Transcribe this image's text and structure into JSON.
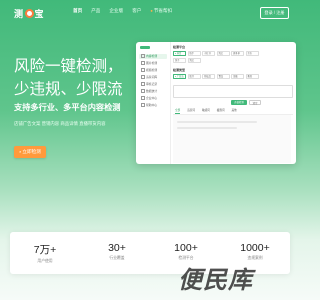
{
  "header": {
    "logo_text_left": "测",
    "logo_text_right": "宝",
    "nav": [
      {
        "label": "首页",
        "active": true
      },
      {
        "label": "产品"
      },
      {
        "label": "企业版"
      },
      {
        "label": "客户"
      },
      {
        "label": "节省帮扣",
        "hot": true
      }
    ],
    "login_label": "登录 / 注册"
  },
  "hero": {
    "title": "风险一键检测，少违规、少限流",
    "subtitle": "支持多行业、多平台内容检测",
    "tags": "店铺广告文案  营销内容  商品详情  直播带货内容",
    "cta_label": "立即检测"
  },
  "mockup": {
    "sidebar": [
      "内容检测",
      "图片检测",
      "视频检测",
      "违禁词库",
      "审核记录",
      "数据统计",
      "企业中心",
      "帮助中心"
    ],
    "section1_label": "检测平台",
    "section1_options": [
      "抖音",
      "快手",
      "小红书",
      "淘宝",
      "拼多多",
      "京东"
    ],
    "section2_label": "检测类型",
    "section2_options": [
      "广告法",
      "医疗",
      "化妆品",
      "食品",
      "金融",
      "教育"
    ],
    "btn_primary": "开始检测",
    "btn_ghost": "清空",
    "result_tabs": [
      "全部",
      "违禁词",
      "敏感词",
      "极限词",
      "其他"
    ]
  },
  "stats": [
    {
      "num": "7万+",
      "label": "用户使用"
    },
    {
      "num": "30+",
      "label": "行业覆盖"
    },
    {
      "num": "100+",
      "label": "检测平台"
    },
    {
      "num": "1000+",
      "label": "违规案例"
    }
  ],
  "watermark": "便民库",
  "colors": {
    "brand": "#41b97a",
    "accent": "#ff9a3c"
  }
}
